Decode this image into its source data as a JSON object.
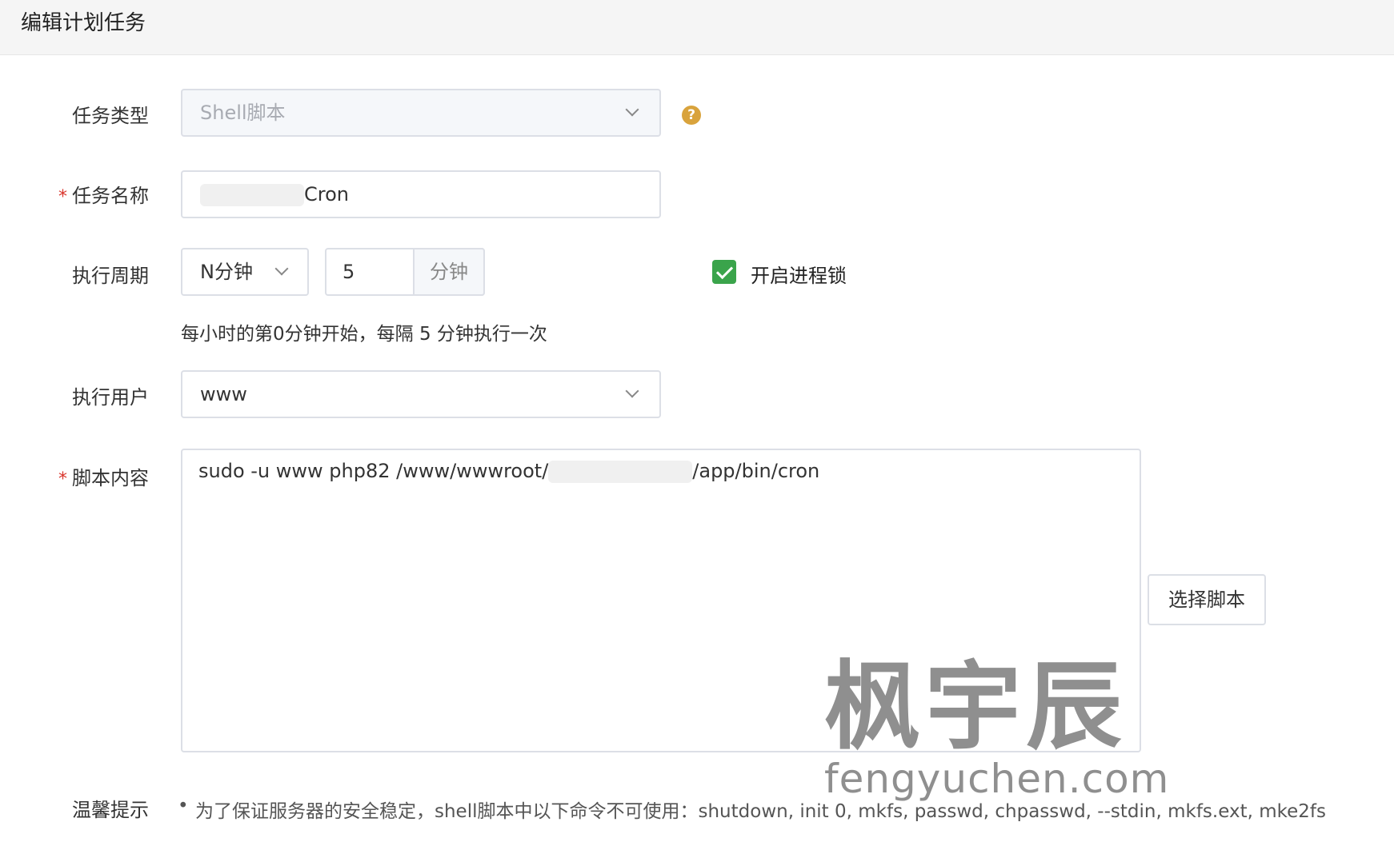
{
  "header": {
    "title": "编辑计划任务"
  },
  "form": {
    "task_type": {
      "label": "任务类型",
      "value": "Shell脚本"
    },
    "task_name": {
      "label": "任务名称",
      "value": "Cron"
    },
    "period": {
      "label": "执行周期",
      "mode": "N分钟",
      "value": "5",
      "unit": "分钟",
      "lock_label": "开启进程锁",
      "lock_checked": true,
      "description": "每小时的第0分钟开始，每隔 5 分钟执行一次"
    },
    "user": {
      "label": "执行用户",
      "value": "www"
    },
    "script": {
      "label": "脚本内容",
      "value_prefix": "sudo -u www php82 /www/wwwroot/",
      "value_suffix": "/app/bin/cron",
      "select_button": "选择脚本"
    },
    "tips": {
      "label": "温馨提示",
      "items": [
        "为了保证服务器的安全稳定，shell脚本中以下命令不可使用：shutdown, init 0, mkfs, passwd, chpasswd, --stdin, mkfs.ext, mke2fs"
      ]
    }
  },
  "watermark": {
    "main": "枫宇辰",
    "sub": "fengyuchen.com"
  },
  "colors": {
    "accent_green": "#3aa44b",
    "help_icon": "#d9a33c",
    "required": "#d9342b"
  }
}
